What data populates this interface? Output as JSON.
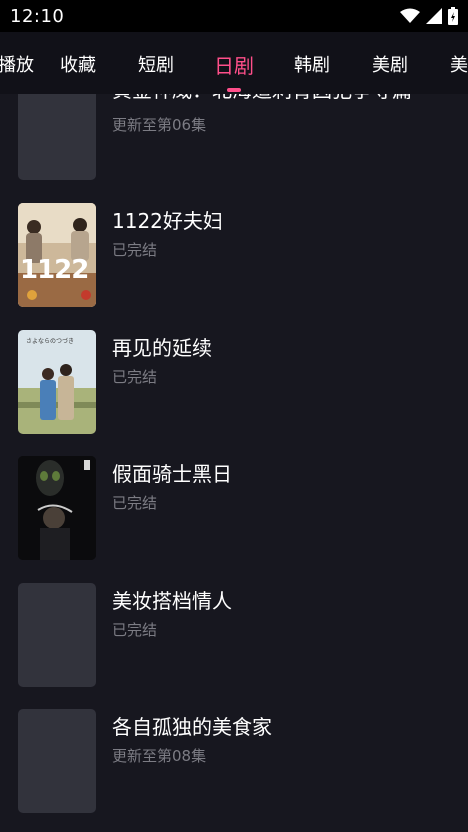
{
  "status_bar": {
    "time": "12:10"
  },
  "tabs": [
    {
      "label": "播放"
    },
    {
      "label": "收藏"
    },
    {
      "label": "短剧"
    },
    {
      "label": "日剧"
    },
    {
      "label": "韩剧"
    },
    {
      "label": "美剧"
    },
    {
      "label": "美"
    }
  ],
  "active_tab": "日剧",
  "colors": {
    "accent": "#ff4f8a",
    "background": "#17171f",
    "subtext": "#7c7c84"
  },
  "items": [
    {
      "title": "黄金神威：北海道刺青囚犯争夺篇",
      "subtitle": "更新至第06集"
    },
    {
      "title": "1122好夫妇",
      "subtitle": "已完结",
      "poster_text": "1122"
    },
    {
      "title": "再见的延续",
      "subtitle": "已完结",
      "poster_text": "さよならのつづき"
    },
    {
      "title": "假面骑士黑日",
      "subtitle": "已完结"
    },
    {
      "title": "美妆搭档情人",
      "subtitle": "已完结"
    },
    {
      "title": "各自孤独的美食家",
      "subtitle": "更新至第08集"
    }
  ]
}
